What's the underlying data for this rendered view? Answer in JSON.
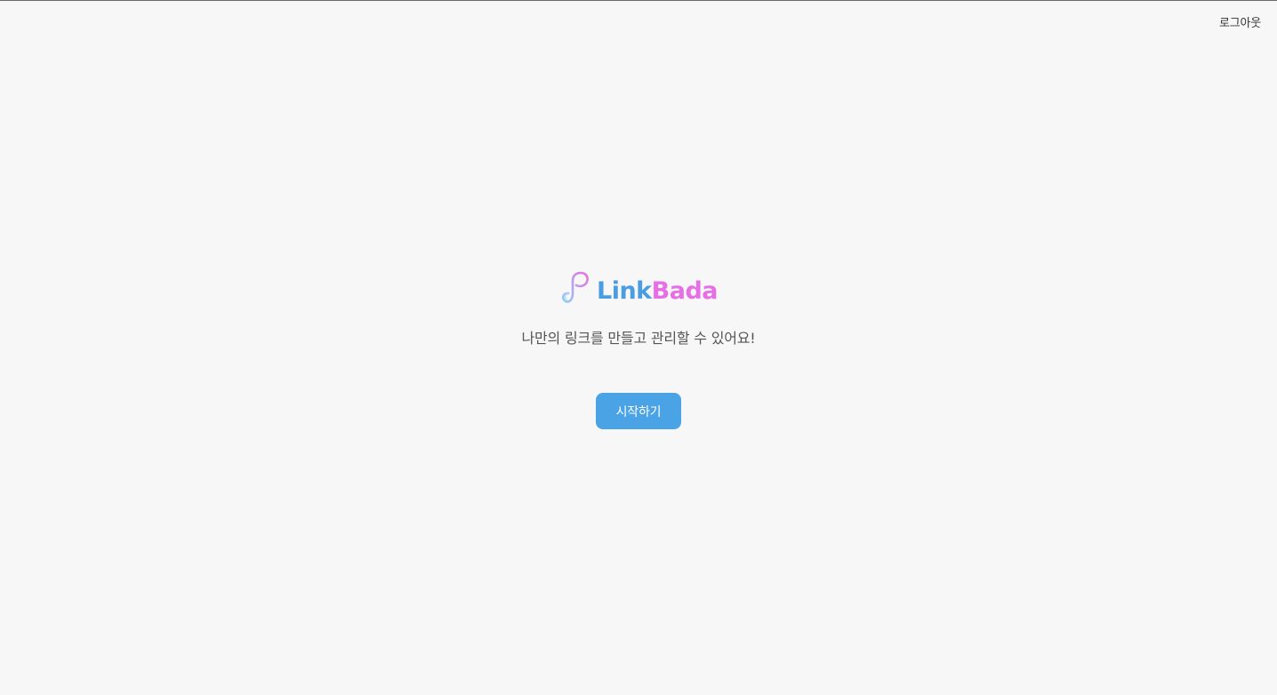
{
  "header": {
    "logout_label": "로그아웃"
  },
  "logo": {
    "text_part1": "Link",
    "text_part2": "Bada",
    "colors": {
      "link": "#4a9de0",
      "bada": "#e76fe6"
    }
  },
  "hero": {
    "tagline": "나만의 링크를 만들고 관리할 수 있어요!",
    "start_label": "시작하기"
  },
  "colors": {
    "background": "#f7f7f8",
    "button": "#4aa3e4",
    "button_text": "#ffffff"
  }
}
